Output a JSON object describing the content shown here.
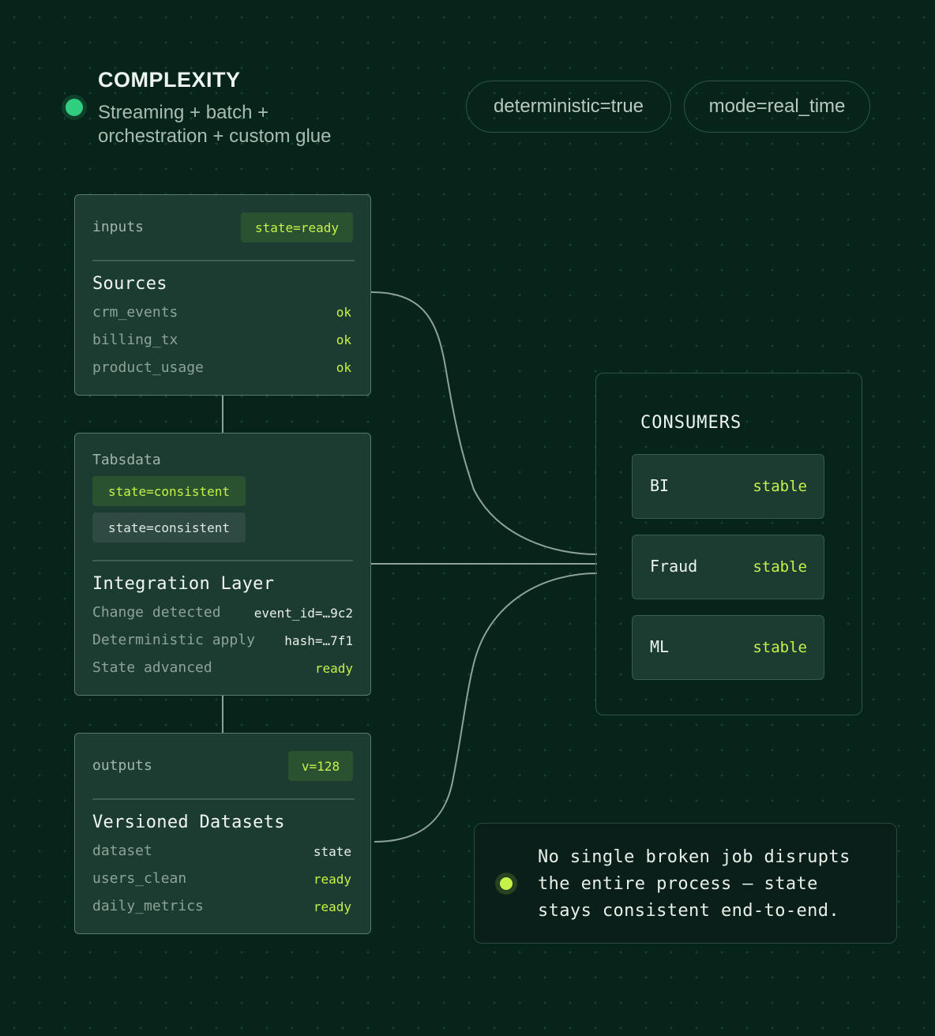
{
  "header": {
    "title": "COMPLEXITY",
    "subtitle": "Streaming + batch + orchestration + custom glue"
  },
  "pills": [
    "deterministic=true",
    "mode=real_time"
  ],
  "inputs_card": {
    "label": "inputs",
    "tag": "state=ready",
    "title": "Sources",
    "rows": [
      {
        "key": "crm_events",
        "value": "ok"
      },
      {
        "key": "billing_tx",
        "value": "ok"
      },
      {
        "key": "product_usage",
        "value": "ok"
      }
    ]
  },
  "tabsdata_card": {
    "label": "Tabsdata",
    "tag_active": "state=consistent",
    "tag_inactive": "state=consistent",
    "title": "Integration Layer",
    "rows": [
      {
        "key": "Change detected",
        "value": "event_id=…9c2"
      },
      {
        "key": "Deterministic apply",
        "value": "hash=…7f1"
      },
      {
        "key": "State advanced",
        "value": "ready"
      }
    ]
  },
  "outputs_card": {
    "label": "outputs",
    "tag": "v=128",
    "title": "Versioned Datasets",
    "rows": [
      {
        "key": "dataset",
        "value": "state"
      },
      {
        "key": "users_clean",
        "value": "ready"
      },
      {
        "key": "daily_metrics",
        "value": "ready"
      }
    ]
  },
  "consumers": {
    "title": "CONSUMERS",
    "items": [
      {
        "name": "BI",
        "status": "stable"
      },
      {
        "name": "Fraud",
        "status": "stable"
      },
      {
        "name": "ML",
        "status": "stable"
      }
    ]
  },
  "note": {
    "lines": [
      "No single broken job disrupts",
      "the entire process — state",
      "stays consistent end-to-end."
    ]
  },
  "colors": {
    "background": "#06241a",
    "accent_lime": "#c6f24a",
    "accent_green": "#2fcf7f",
    "card": "#1c3c31"
  }
}
